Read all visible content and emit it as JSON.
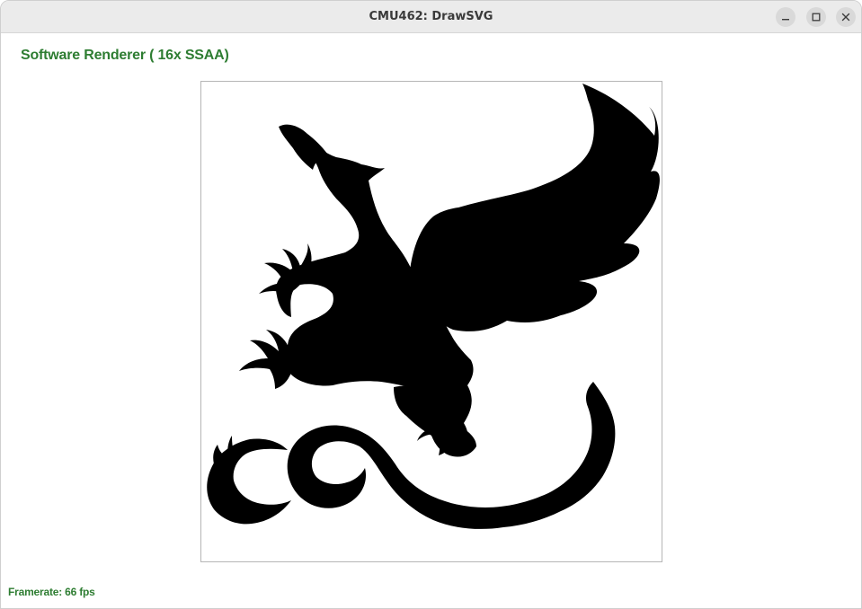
{
  "window": {
    "title": "CMU462: DrawSVG",
    "controls": {
      "minimize_icon": "minimize-icon",
      "maximize_icon": "maximize-icon",
      "close_icon": "close-icon"
    }
  },
  "renderer": {
    "label": "Software Renderer ( 16x SSAA)"
  },
  "canvas": {
    "image": "dragon-silhouette",
    "fill_color": "#000000",
    "background": "#ffffff"
  },
  "status": {
    "framerate": "Framerate: 66 fps"
  },
  "colors": {
    "accent_text": "#2e7d32",
    "titlebar": "#ebebeb"
  }
}
